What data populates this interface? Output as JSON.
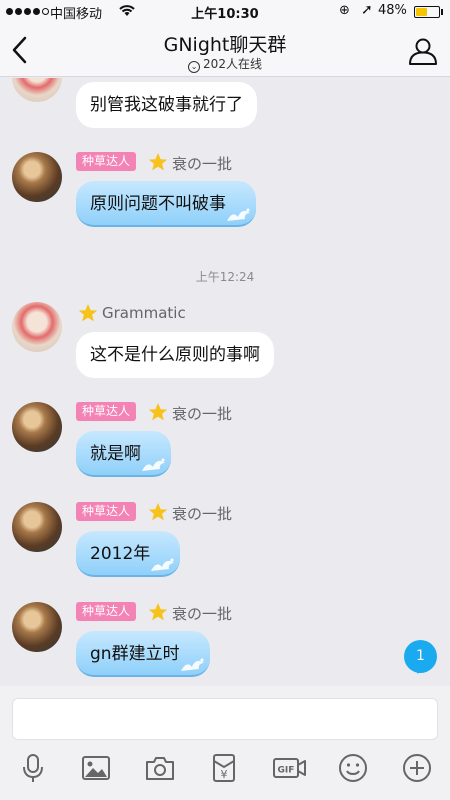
{
  "status": {
    "carrier": "中国移动",
    "time": "上午10:30",
    "battery": "48%",
    "battery_level": 0.48,
    "battery_color": "#f5c400"
  },
  "header": {
    "title": "GNight聊天群",
    "subtitle": "202人在线"
  },
  "messages": [
    {
      "text": "别管我这破事就行了"
    },
    {
      "badge": "种草达人",
      "name": "衰の一批",
      "text": "原则问题不叫破事"
    },
    {
      "timestamp": "上午12:24"
    },
    {
      "name": "Grammatic",
      "text": "这不是什么原则的事啊"
    },
    {
      "badge": "种草达人",
      "name": "衰の一批",
      "text": "就是啊"
    },
    {
      "badge": "种草达人",
      "name": "衰の一批",
      "text": "2012年"
    },
    {
      "badge": "种草达人",
      "name": "衰の一批",
      "text": "gn群建立时"
    }
  ],
  "unread_count": "1",
  "colors": {
    "bubble_blue": "#8fd0f9",
    "badge_pink": "#f483b5",
    "unread_blue": "#1aaaf0"
  },
  "toolbar": {
    "icons": [
      "microphone-icon",
      "image-icon",
      "camera-icon",
      "red-packet-icon",
      "gif-icon",
      "emoji-icon",
      "plus-icon"
    ],
    "gif_label": "GIF",
    "yen_label": "¥"
  }
}
